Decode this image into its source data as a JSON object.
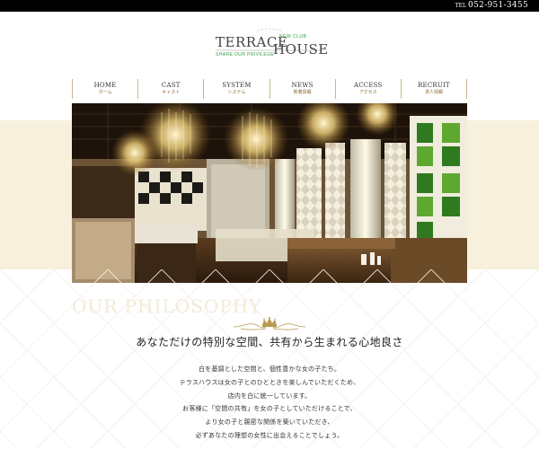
{
  "header": {
    "tel_prefix": "TEL",
    "tel_number": "052-951-3455"
  },
  "logo": {
    "line1": "TERRACE",
    "line2": "HOUSE",
    "newclub": "NEW CLUB",
    "tagline": "SHARE OUR PRIVILEGE"
  },
  "nav": {
    "items": [
      {
        "en": "HOME",
        "jp": "ホーム"
      },
      {
        "en": "CAST",
        "jp": "キャスト"
      },
      {
        "en": "SYSTEM",
        "jp": "システム"
      },
      {
        "en": "NEWS",
        "jp": "新着情報"
      },
      {
        "en": "ACCESS",
        "jp": "アクセス"
      },
      {
        "en": "RECRUIT",
        "jp": "求人情報"
      }
    ]
  },
  "philosophy": {
    "title_en": "OUR PHILOSOPHY",
    "heading": "あなただけの特別な空間、共有から生まれる心地良さ",
    "lines": [
      "白を基調とした空間と、個性豊かな女の子たち。",
      "テラスハウスは女の子とのひとときを楽しんでいただくため、",
      "店内を白に統一しています。",
      "お客様に「空間の共有」を女の子としていただけることで、",
      "より女の子と親密な関係を築いていただき、",
      "必ずあなたの理想の女性に出会えることでしょう。"
    ]
  },
  "colors": {
    "band": "#f6f0dc",
    "nav_border": "#c9b78a",
    "logo_green": "#2f9a43",
    "philosophy_watermark": "#f1ead7"
  },
  "icons": {
    "divider": "crown-ornament-icon",
    "hero": "interior-photo"
  }
}
